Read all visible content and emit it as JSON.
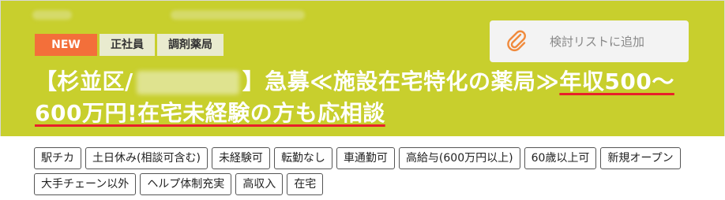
{
  "job": {
    "badges": [
      {
        "label": "NEW",
        "kind": "new"
      },
      {
        "label": "正社員",
        "kind": "category"
      },
      {
        "label": "調剤薬局",
        "kind": "category"
      }
    ],
    "bookmark_label": "検討リストに追加",
    "title": {
      "prefix": "【杉並区/",
      "middle": "】急募≪施設在宅特化の薬局≫",
      "highlight1": "年収500～",
      "highlight2": "600万円!在宅未経験の方も応相談"
    },
    "tags": [
      "駅チカ",
      "土日休み(相談可含む)",
      "未経験可",
      "転勤なし",
      "車通勤可",
      "高給与(600万円以上)",
      "60歳以上可",
      "新規オープン",
      "大手チェーン以外",
      "ヘルプ体制充実",
      "高収入",
      "在宅"
    ]
  },
  "colors": {
    "header_bg": "#c8cf2d",
    "new_badge": "#f36f3a",
    "underline": "#e8202a"
  },
  "icons": {
    "bookmark": "paperclip-icon"
  }
}
